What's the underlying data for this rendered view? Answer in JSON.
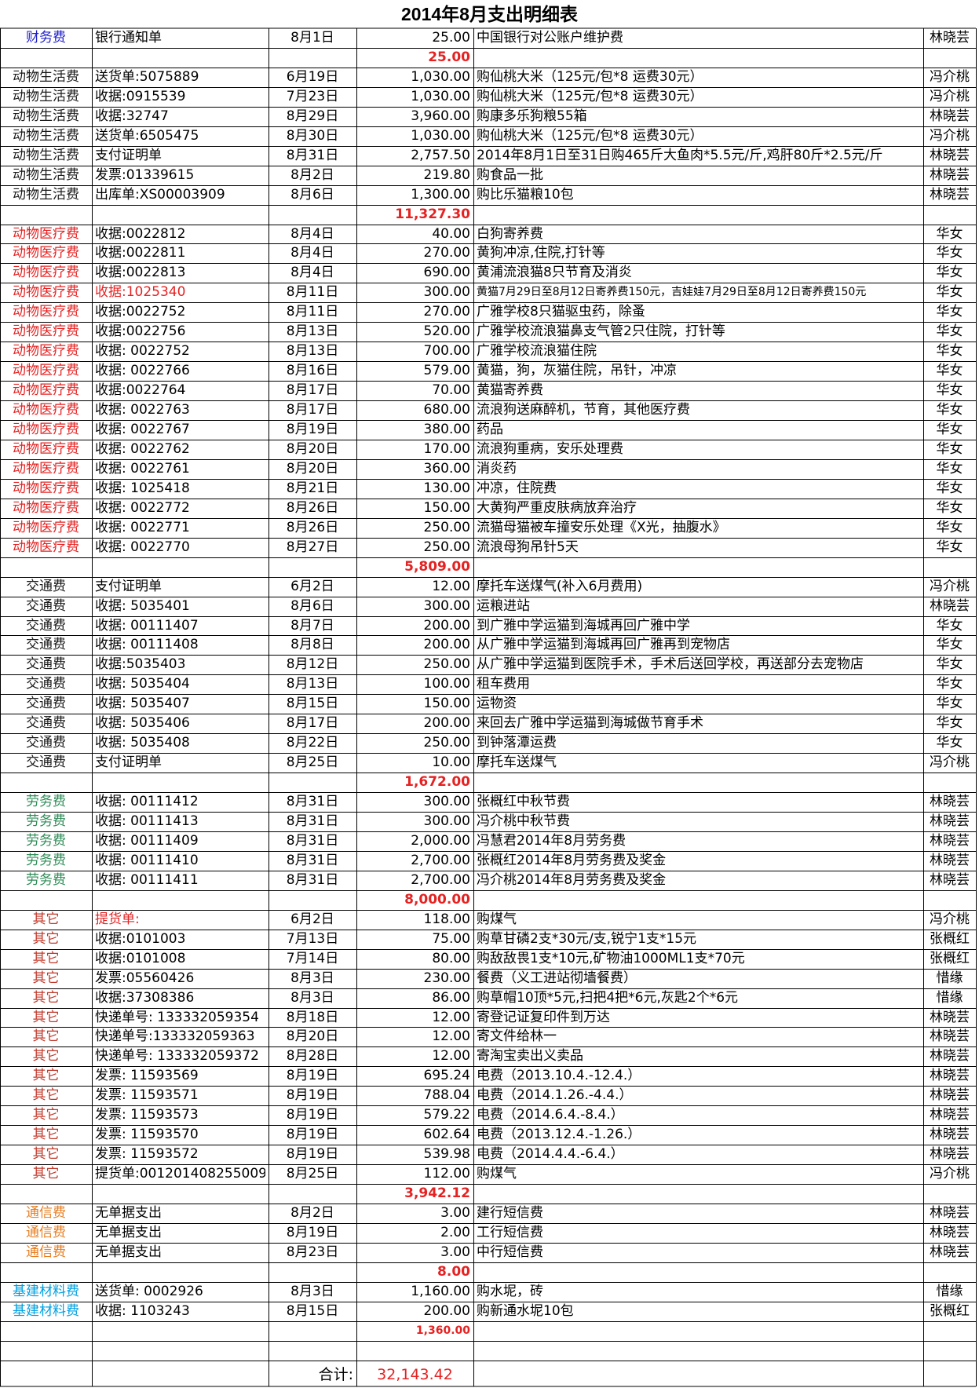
{
  "title": "2014年8月支出明细表",
  "colors": {
    "finance": "#1f1fcc",
    "living": "#1a1a1a",
    "medical": "#e52222",
    "transport": "#1a1a1a",
    "labor": "#2e8b57",
    "other": "#c0392b",
    "telecom": "#e67e22",
    "material": "#00a0e0",
    "subtotal": "#e52222",
    "grid": "#000000"
  },
  "groups": [
    {
      "key": "finance",
      "rows": [
        {
          "category": "财务费",
          "doc": "银行通知单",
          "date": "8月1日",
          "amount": "25.00",
          "desc": "中国银行对公账户维护费",
          "person": "林晓芸"
        }
      ],
      "subtotal": "25.00"
    },
    {
      "key": "living",
      "rows": [
        {
          "category": "动物生活费",
          "doc": "送货单:5075889",
          "date": "6月19日",
          "amount": "1,030.00",
          "desc": "购仙桃大米（125元/包*8 运费30元）",
          "person": "冯介桃"
        },
        {
          "category": "动物生活费",
          "doc": "收据:0915539",
          "date": "7月23日",
          "amount": "1,030.00",
          "desc": "购仙桃大米（125元/包*8 运费30元）",
          "person": "冯介桃"
        },
        {
          "category": "动物生活费",
          "doc": "收据:32747",
          "date": "8月29日",
          "amount": "3,960.00",
          "desc": "购康多乐狗粮55箱",
          "person": "林晓芸"
        },
        {
          "category": "动物生活费",
          "doc": "送货单:6505475",
          "date": "8月30日",
          "amount": "1,030.00",
          "desc": "购仙桃大米（125元/包*8 运费30元）",
          "person": "冯介桃"
        },
        {
          "category": "动物生活费",
          "doc": "支付证明单",
          "date": "8月31日",
          "amount": "2,757.50",
          "desc": "2014年8月1日至31日购465斤大鱼肉*5.5元/斤,鸡肝80斤*2.5元/斤",
          "person": "林晓芸"
        },
        {
          "category": "动物生活费",
          "doc": "发票:01339615",
          "date": "8月2日",
          "amount": "219.80",
          "desc": "购食品一批",
          "person": "林晓芸"
        },
        {
          "category": "动物生活费",
          "doc": "出库单:XS00003909",
          "date": "8月6日",
          "amount": "1,300.00",
          "desc": "购比乐猫粮10包",
          "person": "林晓芸"
        }
      ],
      "subtotal": "11,327.30"
    },
    {
      "key": "medical",
      "rows": [
        {
          "category": "动物医疗费",
          "doc": "收据:0022812",
          "date": "8月4日",
          "amount": "40.00",
          "desc": "白狗寄养费",
          "person": "华女"
        },
        {
          "category": "动物医疗费",
          "doc": "收据:0022811",
          "date": "8月4日",
          "amount": "270.00",
          "desc": "黄狗冲凉,住院,打针等",
          "person": "华女"
        },
        {
          "category": "动物医疗费",
          "doc": "收据:0022813",
          "date": "8月4日",
          "amount": "690.00",
          "desc": "黄浦流浪猫8只节育及消炎",
          "person": "华女"
        },
        {
          "category": "动物医疗费",
          "doc": "收据:1025340",
          "date": "8月11日",
          "amount": "300.00",
          "desc": "黄猫7月29日至8月12日寄养费150元，吉娃娃7月29日至8月12日寄养费150元",
          "person": "华女",
          "docColor": "#e52222",
          "small": true
        },
        {
          "category": "动物医疗费",
          "doc": "收据:0022752",
          "date": "8月11日",
          "amount": "270.00",
          "desc": "广雅学校8只猫驱虫药，除蚤",
          "person": "华女"
        },
        {
          "category": "动物医疗费",
          "doc": "收据:0022756",
          "date": "8月13日",
          "amount": "520.00",
          "desc": "广雅学校流浪猫鼻支气管2只住院，打针等",
          "person": "华女"
        },
        {
          "category": "动物医疗费",
          "doc": "收据: 0022752",
          "date": "8月13日",
          "amount": "700.00",
          "desc": "广雅学校流浪猫住院",
          "person": "华女"
        },
        {
          "category": "动物医疗费",
          "doc": "收据: 0022766",
          "date": "8月16日",
          "amount": "579.00",
          "desc": "黄猫，狗，灰猫住院，吊针，冲凉",
          "person": "华女"
        },
        {
          "category": "动物医疗费",
          "doc": "收据:0022764",
          "date": "8月17日",
          "amount": "70.00",
          "desc": "黄猫寄养费",
          "person": "华女"
        },
        {
          "category": "动物医疗费",
          "doc": "收据: 0022763",
          "date": "8月17日",
          "amount": "680.00",
          "desc": "流浪狗送麻醉机，节育，其他医疗费",
          "person": "华女"
        },
        {
          "category": "动物医疗费",
          "doc": "收据: 0022767",
          "date": "8月19日",
          "amount": "380.00",
          "desc": "药品",
          "person": "华女"
        },
        {
          "category": "动物医疗费",
          "doc": "收据: 0022762",
          "date": "8月20日",
          "amount": "170.00",
          "desc": "流浪狗重病，安乐处理费",
          "person": "华女"
        },
        {
          "category": "动物医疗费",
          "doc": "收据: 0022761",
          "date": "8月20日",
          "amount": "360.00",
          "desc": "消炎药",
          "person": "华女"
        },
        {
          "category": "动物医疗费",
          "doc": "收据: 1025418",
          "date": "8月21日",
          "amount": "130.00",
          "desc": "冲凉，住院费",
          "person": "华女"
        },
        {
          "category": "动物医疗费",
          "doc": "收据: 0022772",
          "date": "8月26日",
          "amount": "150.00",
          "desc": "大黄狗严重皮肤病放弃治疗",
          "person": "华女"
        },
        {
          "category": "动物医疗费",
          "doc": "收据: 0022771",
          "date": "8月26日",
          "amount": "250.00",
          "desc": "流猫母猫被车撞安乐处理《X光，抽腹水》",
          "person": "华女"
        },
        {
          "category": "动物医疗费",
          "doc": "收据: 0022770",
          "date": "8月27日",
          "amount": "250.00",
          "desc": "流浪母狗吊针5天",
          "person": "华女"
        }
      ],
      "subtotal": "5,809.00"
    },
    {
      "key": "transport",
      "rows": [
        {
          "category": "交通费",
          "doc": "支付证明单",
          "date": "6月2日",
          "amount": "12.00",
          "desc": "摩托车送煤气(补入6月费用)",
          "person": "冯介桃"
        },
        {
          "category": "交通费",
          "doc": "收据: 5035401",
          "date": "8月6日",
          "amount": "300.00",
          "desc": "运粮进站",
          "person": "林晓芸"
        },
        {
          "category": "交通费",
          "doc": "收据: 00111407",
          "date": "8月7日",
          "amount": "200.00",
          "desc": "到广雅中学运猫到海城再回广雅中学",
          "person": "华女"
        },
        {
          "category": "交通费",
          "doc": "收据: 00111408",
          "date": "8月8日",
          "amount": "200.00",
          "desc": "从广雅中学运猫到海城再回广雅再到宠物店",
          "person": "华女"
        },
        {
          "category": "交通费",
          "doc": "收据:5035403",
          "date": "8月12日",
          "amount": "250.00",
          "desc": "从广雅中学运猫到医院手术，手术后送回学校，再送部分去宠物店",
          "person": "华女"
        },
        {
          "category": "交通费",
          "doc": "收据: 5035404",
          "date": "8月13日",
          "amount": "100.00",
          "desc": "租车费用",
          "person": "华女"
        },
        {
          "category": "交通费",
          "doc": "收据: 5035407",
          "date": "8月15日",
          "amount": "150.00",
          "desc": "运物资",
          "person": "华女"
        },
        {
          "category": "交通费",
          "doc": "收据: 5035406",
          "date": "8月17日",
          "amount": "200.00",
          "desc": "来回去广雅中学运猫到海城做节育手术",
          "person": "华女"
        },
        {
          "category": "交通费",
          "doc": "收据: 5035408",
          "date": "8月22日",
          "amount": "250.00",
          "desc": "到钟落潭运费",
          "person": "华女"
        },
        {
          "category": "交通费",
          "doc": "支付证明单",
          "date": "8月25日",
          "amount": "10.00",
          "desc": "摩托车送煤气",
          "person": "冯介桃"
        }
      ],
      "subtotal": "1,672.00"
    },
    {
      "key": "labor",
      "rows": [
        {
          "category": "劳务费",
          "doc": "收据: 00111412",
          "date": "8月31日",
          "amount": "300.00",
          "desc": "张概红中秋节费",
          "person": "林晓芸"
        },
        {
          "category": "劳务费",
          "doc": "收据: 00111413",
          "date": "8月31日",
          "amount": "300.00",
          "desc": "冯介桃中秋节费",
          "person": "林晓芸"
        },
        {
          "category": "劳务费",
          "doc": "收据: 00111409",
          "date": "8月31日",
          "amount": "2,000.00",
          "desc": "冯慧君2014年8月劳务费",
          "person": "林晓芸"
        },
        {
          "category": "劳务费",
          "doc": "收据: 00111410",
          "date": "8月31日",
          "amount": "2,700.00",
          "desc": "张概红2014年8月劳务费及奖金",
          "person": "林晓芸"
        },
        {
          "category": "劳务费",
          "doc": "收据: 00111411",
          "date": "8月31日",
          "amount": "2,700.00",
          "desc": "冯介桃2014年8月劳务费及奖金",
          "person": "林晓芸"
        }
      ],
      "subtotal": "8,000.00"
    },
    {
      "key": "other",
      "rows": [
        {
          "category": "其它",
          "doc": "提货单:",
          "date": "6月2日",
          "amount": "118.00",
          "desc": "购煤气",
          "person": "冯介桃",
          "docColor": "#e52222"
        },
        {
          "category": "其它",
          "doc": "收据:0101003",
          "date": "7月13日",
          "amount": "75.00",
          "desc": "购草甘磷2支*30元/支,锐宁1支*15元",
          "person": "张概红"
        },
        {
          "category": "其它",
          "doc": "收据:0101008",
          "date": "7月14日",
          "amount": "80.00",
          "desc": "购敌敌畏1支*10元,矿物油1000ML1支*70元",
          "person": "张概红"
        },
        {
          "category": "其它",
          "doc": "发票:05560426",
          "date": "8月3日",
          "amount": "230.00",
          "desc": "餐费（义工进站彻墙餐费）",
          "person": "惜缘"
        },
        {
          "category": "其它",
          "doc": "收据:37308386",
          "date": "8月3日",
          "amount": "86.00",
          "desc": "购草帽10顶*5元,扫把4把*6元,灰匙2个*6元",
          "person": "惜缘"
        },
        {
          "category": "其它",
          "doc": "快递单号: 133332059354",
          "date": "8月18日",
          "amount": "12.00",
          "desc": "寄登记证复印件到万达",
          "person": "林晓芸"
        },
        {
          "category": "其它",
          "doc": "快递单号:133332059363",
          "date": "8月20日",
          "amount": "12.00",
          "desc": "寄文件给林一",
          "person": "林晓芸"
        },
        {
          "category": "其它",
          "doc": "快递单号: 133332059372",
          "date": "8月28日",
          "amount": "12.00",
          "desc": "寄淘宝卖出义卖品",
          "person": "林晓芸"
        },
        {
          "category": "其它",
          "doc": "发票: 11593569",
          "date": "8月19日",
          "amount": "695.24",
          "desc": "电费（2013.10.4.-12.4.）",
          "person": "林晓芸"
        },
        {
          "category": "其它",
          "doc": "发票: 11593571",
          "date": "8月19日",
          "amount": "788.04",
          "desc": "电费（2014.1.26.-4.4.）",
          "person": "林晓芸"
        },
        {
          "category": "其它",
          "doc": "发票: 11593573",
          "date": "8月19日",
          "amount": "579.22",
          "desc": "电费（2014.6.4.-8.4.）",
          "person": "林晓芸"
        },
        {
          "category": "其它",
          "doc": "发票: 11593570",
          "date": "8月19日",
          "amount": "602.64",
          "desc": "电费（2013.12.4.-1.26.）",
          "person": "林晓芸"
        },
        {
          "category": "其它",
          "doc": "发票: 11593572",
          "date": "8月19日",
          "amount": "539.98",
          "desc": "电费（2014.4.4.-6.4.）",
          "person": "林晓芸"
        },
        {
          "category": "其它",
          "doc": "提货单:001201408255009",
          "date": "8月25日",
          "amount": "112.00",
          "desc": "购煤气",
          "person": "冯介桃"
        }
      ],
      "subtotal": "3,942.12"
    },
    {
      "key": "telecom",
      "rows": [
        {
          "category": "通信费",
          "doc": "无单据支出",
          "date": "8月2日",
          "amount": "3.00",
          "desc": "建行短信费",
          "person": "林晓芸"
        },
        {
          "category": "通信费",
          "doc": "无单据支出",
          "date": "8月19日",
          "amount": "2.00",
          "desc": "工行短信费",
          "person": "林晓芸"
        },
        {
          "category": "通信费",
          "doc": "无单据支出",
          "date": "8月23日",
          "amount": "3.00",
          "desc": "中行短信费",
          "person": "林晓芸"
        }
      ],
      "subtotal": "8.00"
    },
    {
      "key": "material",
      "rows": [
        {
          "category": "基建材料费",
          "doc": "送货单: 0002926",
          "date": "8月3日",
          "amount": "1,160.00",
          "desc": "购水坭，砖",
          "person": "惜缘"
        },
        {
          "category": "基建材料费",
          "doc": "收据: 1103243",
          "date": "8月15日",
          "amount": "200.00",
          "desc": "购新通水坭10包",
          "person": "张概红"
        }
      ],
      "subtotal": "1,360.00",
      "smallSubtotal": true
    }
  ],
  "total": {
    "label": "合计:",
    "value": "32,143.42"
  }
}
